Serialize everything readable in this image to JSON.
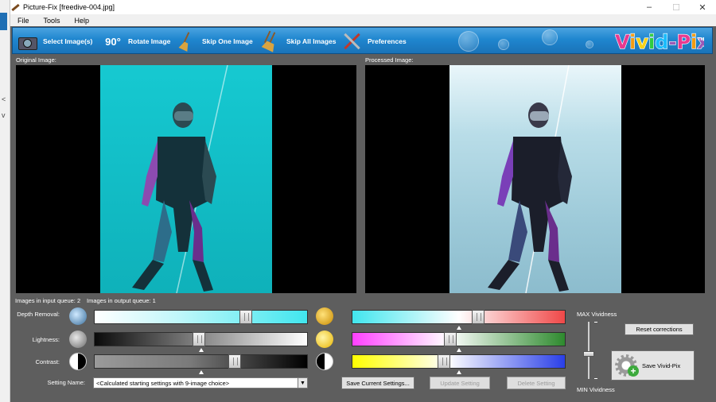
{
  "window": {
    "title": "Picture-Fix  [freedive-004.jpg]",
    "controls": [
      "–",
      "☐",
      "✕"
    ]
  },
  "menu": [
    "File",
    "Tools",
    "Help"
  ],
  "toolbar": {
    "select_images": "Select Image(s)",
    "rotate_badge": "90°",
    "rotate_image": "Rotate Image",
    "skip_one": "Skip One Image",
    "skip_all": "Skip All Images",
    "preferences": "Preferences",
    "logo": "Vivid-Pix",
    "logo_mark": "TM"
  },
  "panels": {
    "original_label": "Original Image:",
    "processed_label": "Processed Image:"
  },
  "queue": {
    "input_label": "Images in input queue:",
    "input_count": "2",
    "output_label": "Images in output queue:",
    "output_count": "1"
  },
  "adjustments": {
    "depth_label": "Depth Removal:",
    "lightness_label": "Lightness:",
    "contrast_label": "Contrast:",
    "depth_value": 0.71,
    "lightness_value": 0.49,
    "contrast_value": 0.66,
    "cyan_red_value": 0.59,
    "magenta_green_value": 0.46,
    "yellow_blue_value": 0.43
  },
  "setting": {
    "label": "Setting Name:",
    "value": "<Calculated starting settings with 9-image choice>"
  },
  "buttons": {
    "save_current": "Save Current Settings...",
    "update": "Update Setting",
    "delete": "Delete Setting",
    "reset": "Reset corrections",
    "save_vivid": "Save Vivid-Pix"
  },
  "vividness": {
    "max_label": "MAX Vividness",
    "min_label": "MIN Vividness",
    "value": 0.45
  },
  "colors": {
    "toolbar": "#1f86cf",
    "workspace": "#5e5e5e",
    "cyan": "#41e6ee",
    "red": "#f04848",
    "magenta": "#ff40ff",
    "green": "#2e8a2e",
    "yellow": "#ffff00",
    "blue": "#2a3fe8"
  }
}
